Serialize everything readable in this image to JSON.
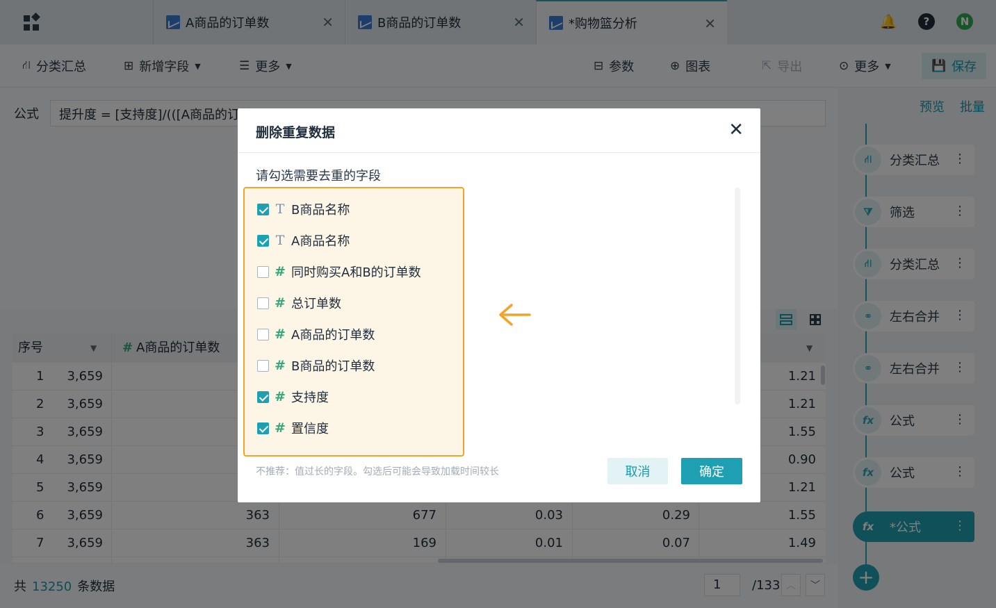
{
  "tabs": [
    {
      "label": "A商品的订单数",
      "active": false
    },
    {
      "label": "B商品的订单数",
      "active": false
    },
    {
      "label": "*购物篮分析",
      "active": true
    }
  ],
  "user_avatar_letter": "N",
  "toolbar": {
    "group_summary": "分类汇总",
    "add_field": "新增字段",
    "more_left": "更多",
    "params": "参数",
    "chart": "图表",
    "export": "导出",
    "more_right": "更多",
    "save": "保存"
  },
  "formula": {
    "label": "公式",
    "value": "提升度 = [支持度]/(([A商品的订单"
  },
  "grid": {
    "headers": {
      "index": "序号",
      "a_orders": "A商品的订单数"
    },
    "rows": [
      {
        "idx": "1",
        "c1": "3,659",
        "c2": "",
        "c3": "",
        "c4": "",
        "c5": "",
        "c6": "1.21"
      },
      {
        "idx": "2",
        "c1": "3,659",
        "c2": "",
        "c3": "",
        "c4": "",
        "c5": "",
        "c6": "1.21"
      },
      {
        "idx": "3",
        "c1": "3,659",
        "c2": "",
        "c3": "",
        "c4": "",
        "c5": "",
        "c6": "1.55"
      },
      {
        "idx": "4",
        "c1": "3,659",
        "c2": "",
        "c3": "",
        "c4": "",
        "c5": "",
        "c6": "0.90"
      },
      {
        "idx": "5",
        "c1": "3,659",
        "c2": "",
        "c3": "",
        "c4": "",
        "c5": "",
        "c6": "1.21"
      },
      {
        "idx": "6",
        "c1": "3,659",
        "c2": "363",
        "c3": "677",
        "c4": "0.03",
        "c5": "0.29",
        "c6": "1.55"
      },
      {
        "idx": "7",
        "c1": "3,659",
        "c2": "363",
        "c3": "169",
        "c4": "0.01",
        "c5": "0.07",
        "c6": "1.49"
      }
    ]
  },
  "footer": {
    "prefix": "共",
    "count": "13250",
    "suffix": "条数据",
    "page": "1",
    "total_pages": "/133"
  },
  "sidebar": {
    "preview": "预览",
    "batch": "批量",
    "steps": [
      {
        "label": "分类汇总",
        "icon": "group-icon"
      },
      {
        "label": "筛选",
        "icon": "filter-icon"
      },
      {
        "label": "分类汇总",
        "icon": "group-icon"
      },
      {
        "label": "左右合并",
        "icon": "merge-icon"
      },
      {
        "label": "左右合并",
        "icon": "merge-icon"
      },
      {
        "label": "公式",
        "icon": "fx-icon"
      },
      {
        "label": "公式",
        "icon": "fx-icon"
      },
      {
        "label": "*公式",
        "icon": "fx-icon",
        "active": true
      }
    ]
  },
  "modal": {
    "title": "删除重复数据",
    "subtitle": "请勾选需要去重的字段",
    "fields": [
      {
        "label": "B商品名称",
        "type": "text",
        "checked": true
      },
      {
        "label": "A商品名称",
        "type": "text",
        "checked": true
      },
      {
        "label": "同时购买A和B的订单数",
        "type": "number",
        "checked": false
      },
      {
        "label": "总订单数",
        "type": "number",
        "checked": false
      },
      {
        "label": "A商品的订单数",
        "type": "number",
        "checked": false
      },
      {
        "label": "B商品的订单数",
        "type": "number",
        "checked": false
      },
      {
        "label": "支持度",
        "type": "number",
        "checked": true
      },
      {
        "label": "置信度",
        "type": "number",
        "checked": true
      }
    ],
    "hint": "不推荐：值过长的字段。勾选后可能会导致加载时间较长",
    "cancel": "取消",
    "confirm": "确定"
  },
  "colors": {
    "accent": "#1fa0b2",
    "highlight_border": "#f3a428",
    "highlight_fill": "#fdf6e6"
  }
}
